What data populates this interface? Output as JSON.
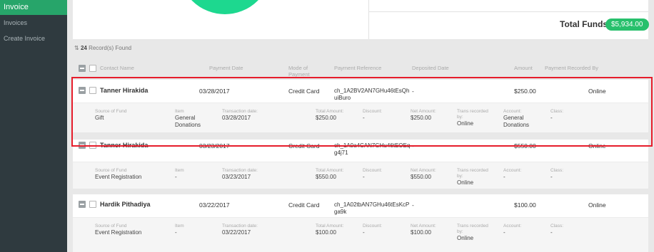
{
  "sidebar": {
    "items": [
      {
        "label": "Invoice",
        "active": true
      },
      {
        "label": "Invoices"
      },
      {
        "label": "Create Invoice"
      }
    ]
  },
  "summary": {
    "total_label": "Total Funds :",
    "total_value": "$5,934.00"
  },
  "records": {
    "count": "24",
    "suffix": "Record(s) Found"
  },
  "columns": {
    "contact": "Contact Name",
    "date": "Payment Date",
    "mode": "Mode of Payment",
    "ref": "Payment Reference",
    "deposited": "Deposited Date",
    "amount": "Amount",
    "recorded": "Payment Recorded By"
  },
  "detail_labels": {
    "source": "Source of Fund",
    "item": "Item",
    "txdate": "Transaction date:",
    "total": "Total Amount:",
    "discount": "Discount:",
    "net": "Net Amount:",
    "trans": "Trans recorded by:",
    "account": "Account:",
    "class": "Class:"
  },
  "rows": [
    {
      "name": "Tanner Hirakida",
      "date": "03/28/2017",
      "mode": "Credit Card",
      "ref": "ch_1A2BV2AN7GHu46tEsQh uiBuro",
      "deposited": "-",
      "amount": "$250.00",
      "recorded": "Online",
      "source": "Gift",
      "item": "General Donations",
      "txdate": "03/28/2017",
      "total": "$250.00",
      "discount": "-",
      "net": "$250.00",
      "trans": "Online",
      "account": "General Donations",
      "class": "-"
    },
    {
      "name": "Tanner Hirakida",
      "date": "03/23/2017",
      "mode": "Credit Card",
      "ref": "ch_1A0a4CAN7GHu46tEOEq g4j71",
      "deposited": "-",
      "amount": "$550.00",
      "recorded": "Online",
      "source": "Event Registration",
      "item": "-",
      "txdate": "03/23/2017",
      "total": "$550.00",
      "discount": "-",
      "net": "$550.00",
      "trans": "Online",
      "account": "-",
      "class": "-"
    },
    {
      "name": "Hardik Pithadiya",
      "date": "03/22/2017",
      "mode": "Credit Card",
      "ref": "ch_1A02tbAN7GHu46tEsKcP ga9k",
      "deposited": "-",
      "amount": "$100.00",
      "recorded": "Online",
      "source": "Event Registration",
      "item": "-",
      "txdate": "03/22/2017",
      "total": "$100.00",
      "discount": "-",
      "net": "$100.00",
      "trans": "Online",
      "account": "-",
      "class": "-"
    }
  ],
  "colors": {
    "accent": "#27a56a",
    "donut": "#1dd88f",
    "badge": "#27c06c",
    "highlight": "#e61d2b"
  }
}
